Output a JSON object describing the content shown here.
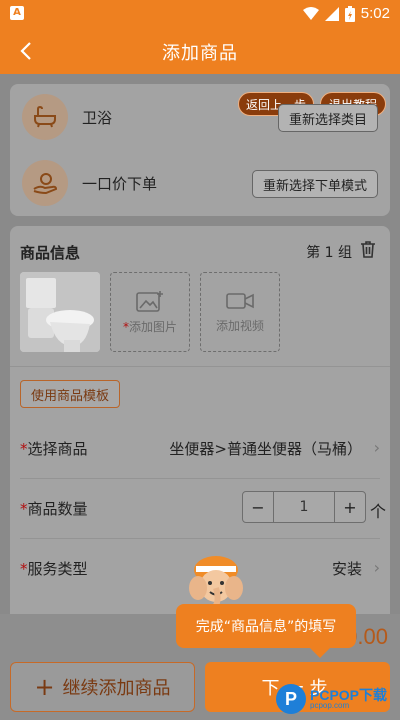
{
  "status_bar": {
    "time": "5:02",
    "app_icon": "A",
    "icons": [
      "wifi-icon",
      "signal-icon",
      "battery-icon"
    ]
  },
  "header": {
    "title": "添加商品",
    "back_icon": "chevron-left-icon"
  },
  "colors": {
    "accent": "#ee8020",
    "required": "#b01010",
    "overlay_gray": "#8a8a8a"
  },
  "tutorial": {
    "back_label": "返回上一步",
    "exit_label": "退出教程",
    "hint": "完成“商品信息”的填写"
  },
  "category": {
    "name": "卫浴",
    "reselect_label": "重新选择类目"
  },
  "order_mode": {
    "name": "一口价下单",
    "reselect_label": "重新选择下单模式"
  },
  "product_info": {
    "title": "商品信息",
    "group_label": "第 1 组",
    "add_image_label": "添加图片",
    "add_video_label": "添加视频",
    "template_button": "使用商品模板",
    "select_product": {
      "label": "选择商品",
      "value": "坐便器>普通坐便器（马桶）"
    },
    "quantity": {
      "label": "商品数量",
      "value": "1",
      "minus": "−",
      "plus": "+",
      "unit": "个"
    },
    "service_type": {
      "label": "服务类型",
      "value": "安装"
    }
  },
  "bottom_bar": {
    "price_partial": "0.00",
    "add_more_label": "继续添加商品",
    "next_label": "下一步"
  },
  "watermark": {
    "logo": "P",
    "main": "PCPOP下载",
    "sub": "pcpop.com"
  }
}
